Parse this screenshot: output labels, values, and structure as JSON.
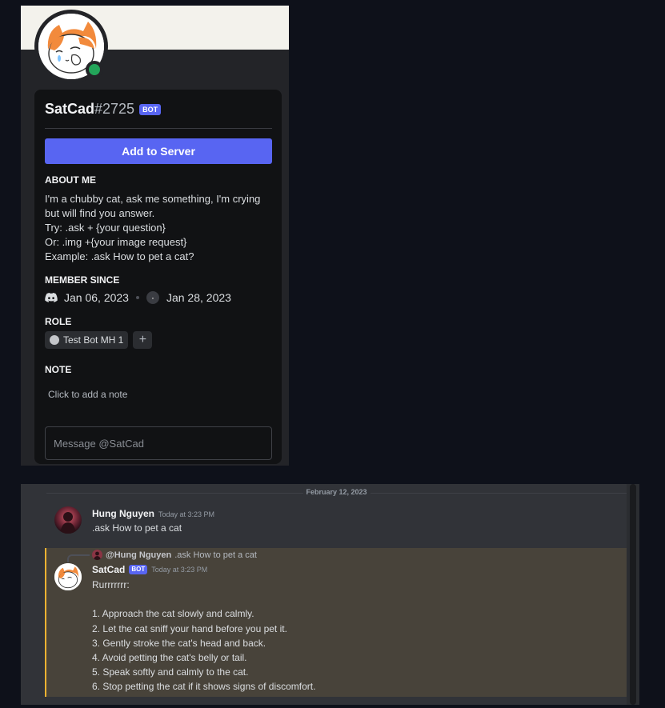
{
  "profile": {
    "username": "SatCad",
    "discriminator": "#2725",
    "bot_tag": "BOT",
    "status": "online",
    "add_to_server_label": "Add to Server",
    "about_title": "ABOUT ME",
    "about_lines": [
      "I'm a chubby cat, ask me something, I'm crying",
      "but will find you answer.",
      "Try: .ask + {your question}",
      "Or: .img +{your image request}",
      "Example: .ask How to pet a cat?"
    ],
    "member_since_title": "MEMBER SINCE",
    "discord_join_date": "Jan 06, 2023",
    "server_join_date": "Jan 28, 2023",
    "role_title": "ROLE",
    "role_name": "Test Bot MH 1",
    "note_title": "NOTE",
    "note_placeholder": "Click to add a note",
    "message_placeholder": "Message @SatCad"
  },
  "chat": {
    "date_divider": "February 12, 2023",
    "messages": [
      {
        "author": "Hung Nguyen",
        "timestamp": "Today at 3:23 PM",
        "text": ".ask How to pet a cat"
      },
      {
        "reply_author": "@Hung Nguyen",
        "reply_text": ".ask How to pet a cat",
        "author": "SatCad",
        "bot_tag": "BOT",
        "timestamp": "Today at 3:23 PM",
        "lines": [
          "Rurrrrrrr:",
          "",
          "1. Approach the cat slowly and calmly.",
          "2. Let the cat sniff your hand before you pet it.",
          "3. Gently stroke the cat's head and back.",
          "4. Avoid petting the cat's belly or tail.",
          "5. Speak softly and calmly to the cat.",
          "6. Stop petting the cat if it shows signs of discomfort."
        ]
      }
    ]
  },
  "colors": {
    "blurple": "#5865f2",
    "online": "#23a55a",
    "mention_highlight_border": "#f0b232"
  }
}
